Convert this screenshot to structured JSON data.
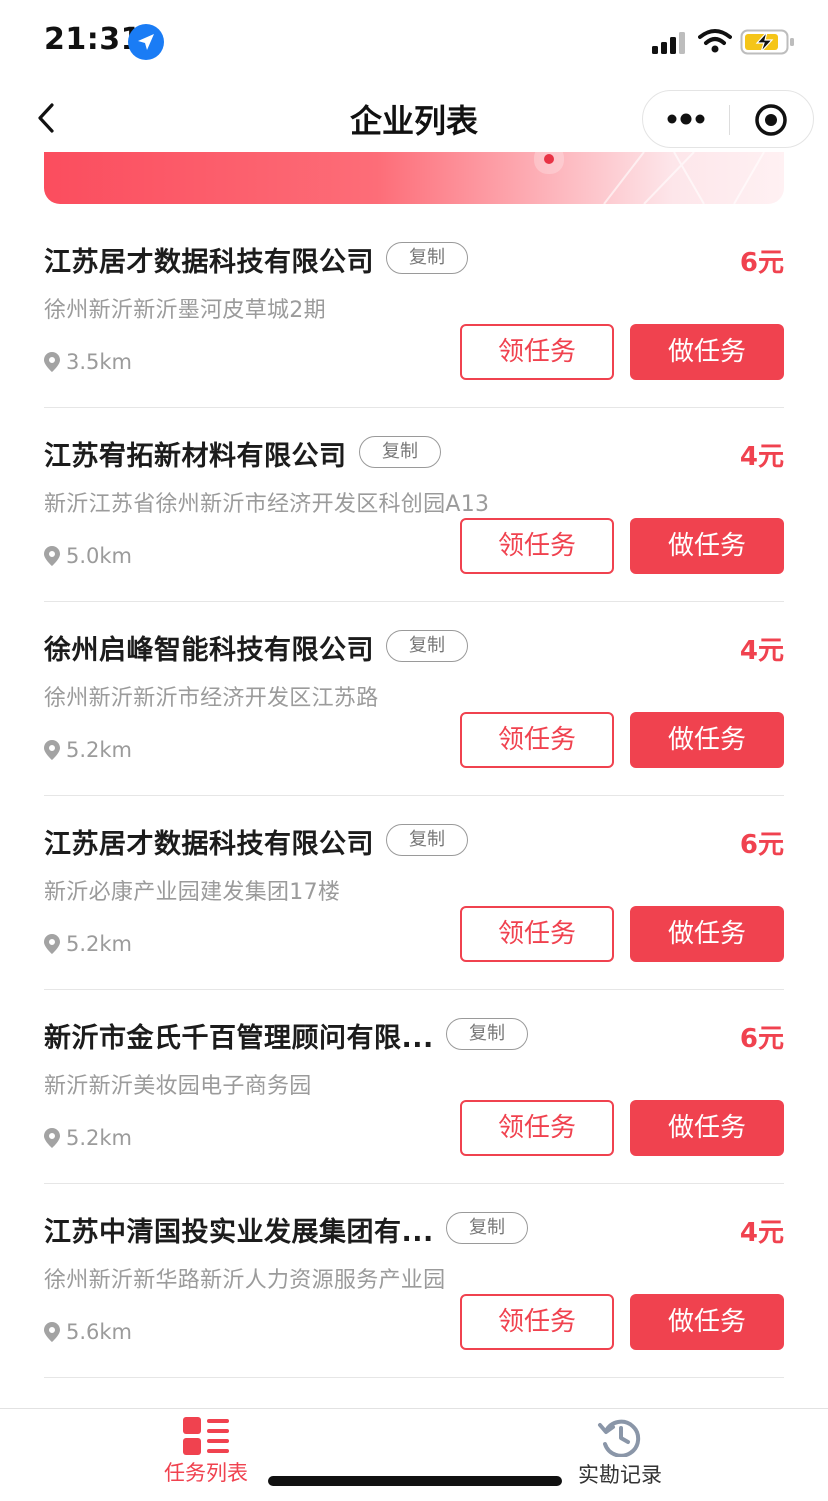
{
  "status_bar": {
    "time": "21:31"
  },
  "nav": {
    "title": "企业列表"
  },
  "copy_label": "复制",
  "claim_label": "领任务",
  "do_label": "做任务",
  "companies": [
    {
      "name": "江苏居才数据科技有限公司",
      "address": "徐州新沂新沂墨河皮草城2期",
      "distance": "3.5km",
      "price": "6元"
    },
    {
      "name": "江苏宥拓新材料有限公司",
      "address": "新沂江苏省徐州新沂市经济开发区科创园A13",
      "distance": "5.0km",
      "price": "4元"
    },
    {
      "name": "徐州启峰智能科技有限公司",
      "address": "徐州新沂新沂市经济开发区江苏路",
      "distance": "5.2km",
      "price": "4元"
    },
    {
      "name": "江苏居才数据科技有限公司",
      "address": "新沂必康产业园建发集团17楼",
      "distance": "5.2km",
      "price": "6元"
    },
    {
      "name": "新沂市金氏千百管理顾问有限...",
      "address": "新沂新沂美妆园电子商务园",
      "distance": "5.2km",
      "price": "6元"
    },
    {
      "name": "江苏中清国投实业发展集团有...",
      "address": "徐州新沂新华路新沂人力资源服务产业园",
      "distance": "5.6km",
      "price": "4元"
    }
  ],
  "tab_bar": {
    "tasks_label": "任务列表",
    "records_label": "实勘记录"
  },
  "colors": {
    "accent": "#f0424f",
    "location_badge": "#1a7cf5",
    "battery_fill": "#f5c518"
  },
  "icons": [
    "location-arrow-icon",
    "signal-icon",
    "wifi-icon",
    "battery-charging-icon",
    "back-chevron-icon",
    "more-dots-icon",
    "target-icon",
    "map-pin-icon",
    "task-list-icon",
    "history-icon"
  ]
}
